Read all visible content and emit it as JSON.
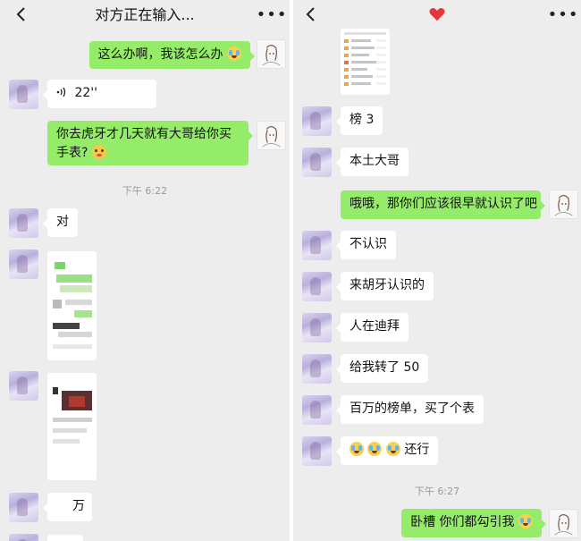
{
  "left": {
    "title": "对方正在输入...",
    "messages": {
      "m1": "这么办啊，我该怎么办",
      "voice_duration": "22''",
      "m3": "你去虎牙才几天就有大哥给你买手表?",
      "time": "下午 6:22",
      "m4": "对",
      "m5": "万"
    }
  },
  "right": {
    "messages": {
      "r1": "榜 3",
      "r2": "本土大哥",
      "r3": "哦哦，那你们应该很早就认识了吧",
      "r4": "不认识",
      "r5": "来胡牙认识的",
      "r6": "人在迪拜",
      "r7": "给我转了 50",
      "r8": "百万的榜单，买了个表",
      "r9": "还行",
      "time": "下午 6:27",
      "r10": "卧槽 你们都勾引我"
    }
  },
  "icons": {
    "back": "chevron-left-icon",
    "more": "more-dots-icon",
    "heart": "red-heart-icon",
    "voice": "voice-wave-icon",
    "emoji_cry": "loudly-crying-emoji",
    "emoji_blush": "flushed-face-emoji",
    "emoji_laugh": "rolling-laughing-emoji"
  },
  "colors": {
    "chat_bg": "#ededed",
    "bubble_in": "#ffffff",
    "bubble_out": "#95ec69",
    "timestamp": "#9a9a9a",
    "heart": "#e5373c"
  }
}
